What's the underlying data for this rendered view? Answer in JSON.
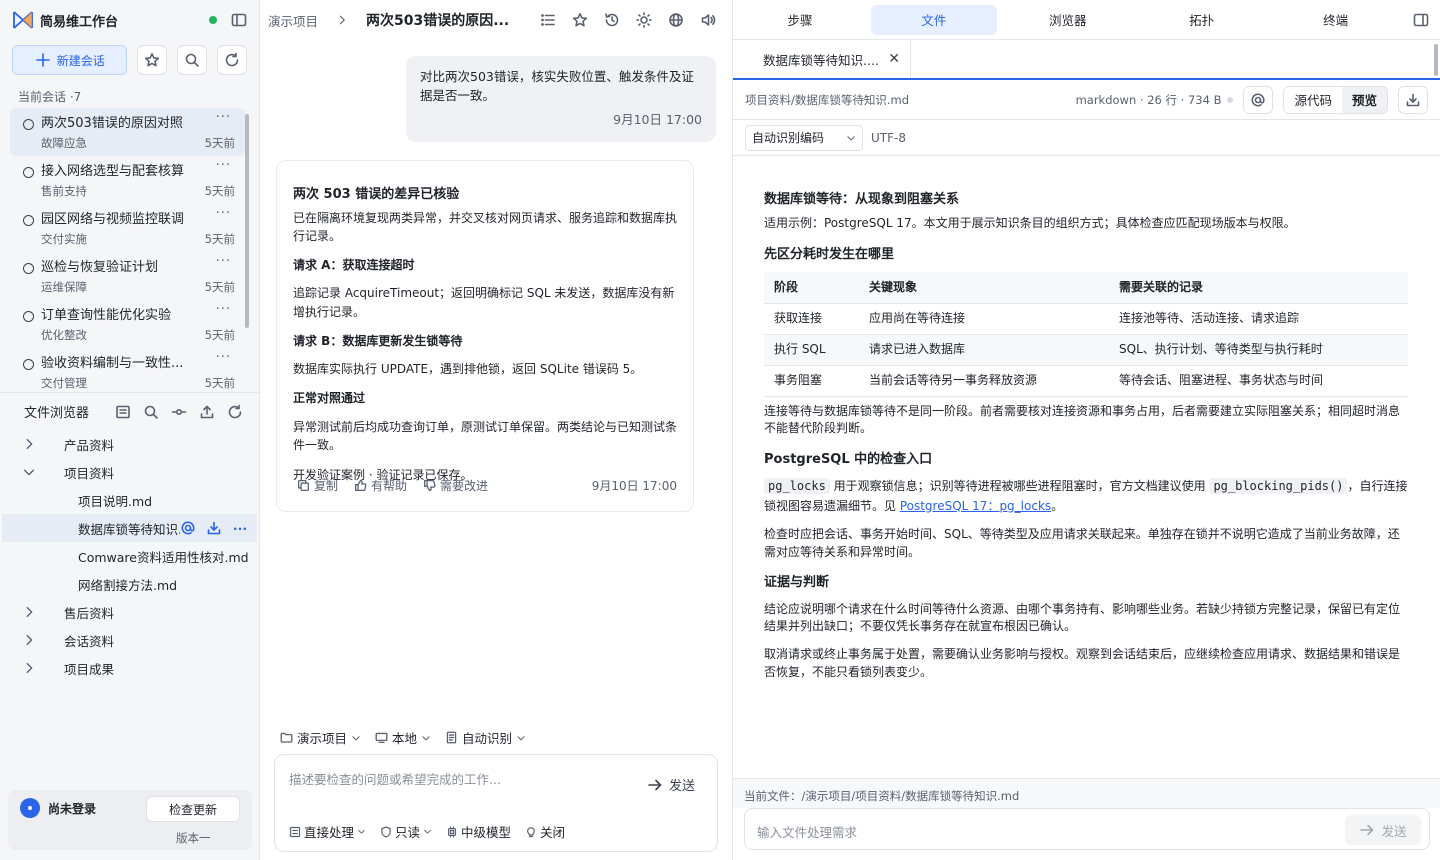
{
  "app": {
    "title": "简易维工作台"
  },
  "sidebar": {
    "new_chat_label": "新建会话",
    "section_label": "当前会话 ·7",
    "sessions": [
      {
        "title": "两次503错误的原因对照",
        "tag": "故障应急",
        "age": "5天前"
      },
      {
        "title": "接入网络选型与配套核算",
        "tag": "售前支持",
        "age": "5天前"
      },
      {
        "title": "园区网络与视频监控联调",
        "tag": "交付实施",
        "age": "5天前"
      },
      {
        "title": "巡检与恢复验证计划",
        "tag": "运维保障",
        "age": "5天前"
      },
      {
        "title": "订单查询性能优化实验",
        "tag": "优化整改",
        "age": "5天前"
      },
      {
        "title": "验收资料编制与一致性...",
        "tag": "交付管理",
        "age": "5天前"
      }
    ],
    "file_browser_label": "文件浏览器",
    "tree": {
      "folder1": "产品资料",
      "folder2": "项目资料",
      "file1": "项目说明.md",
      "file2": "数据库锁等待知识.md",
      "file3": "Comware资料适用性核对.md",
      "file4": "网络割接方法.md",
      "folder3": "售后资料",
      "folder4": "会话资料",
      "folder5": "项目成果"
    },
    "footer": {
      "user": "尚未登录",
      "update_label": "检查更新",
      "version": "版本一"
    }
  },
  "chat": {
    "crumb_project": "演示项目",
    "crumb_title": "两次503错误的原因...",
    "user_msg": "对比两次503错误，核实失败位置、触发条件及证据是否一致。",
    "user_time": "9月10日 17:00",
    "ai": {
      "title": "两次 503 错误的差异已核验",
      "intro": "已在隔离环境复现两类异常，并交叉核对网页请求、服务追踪和数据库执行记录。",
      "h_a": "请求 A：获取连接超时",
      "p_a": "追踪记录 AcquireTimeout；返回明确标记 SQL 未发送，数据库没有新增执行记录。",
      "h_b": "请求 B：数据库更新发生锁等待",
      "p_b": "数据库实际执行 UPDATE，遇到排他锁，返回 SQLite 错误码 5。",
      "h_c": "正常对照通过",
      "p_c": "异常测试前后均成功查询订单，原测试订单保留。两类结论与已知测试条件一致。",
      "foot": "开发验证案例 · 验证记录已保存。",
      "copy": "复制",
      "helpful": "有帮助",
      "improve": "需要改进",
      "time": "9月10日 17:00"
    },
    "ctx": {
      "project": "演示项目",
      "env": "本地",
      "mode": "自动识别"
    },
    "composer": {
      "placeholder": "描述要检查的问题或希望完成的工作...",
      "send": "发送",
      "opt1": "直接处理",
      "opt2": "只读",
      "opt3": "中级模型",
      "opt4": "关闭"
    }
  },
  "right": {
    "tabs": [
      "步骤",
      "文件",
      "浏览器",
      "拓扑",
      "终端"
    ],
    "active_tab": "文件",
    "file_tab": "数据库锁等待知识....",
    "path": "项目资料/数据库锁等待知识.md",
    "meta": "markdown · 26 行 · 734 B",
    "view_source": "源代码",
    "view_preview": "预览",
    "encoding_select": "自动识别编码",
    "encoding_value": "UTF-8",
    "doc": {
      "h1": "数据库锁等待：从现象到阻塞关系",
      "p1": "适用示例：PostgreSQL 17。本文用于展示知识条目的组织方式；具体检查应匹配现场版本与权限。",
      "h2": "先区分耗时发生在哪里",
      "table_head": [
        "阶段",
        "关键现象",
        "需要关联的记录"
      ],
      "table_rows": [
        [
          "获取连接",
          "应用尚在等待连接",
          "连接池等待、活动连接、请求追踪"
        ],
        [
          "执行 SQL",
          "请求已进入数据库",
          "SQL、执行计划、等待类型与执行耗时"
        ],
        [
          "事务阻塞",
          "当前会话等待另一事务释放资源",
          "等待会话、阻塞进程、事务状态与时间"
        ]
      ],
      "p2": "连接等待与数据库锁等待不是同一阶段。前者需要核对连接资源和事务占用，后者需要建立实际阻塞关系；相同超时消息不能替代阶段判断。",
      "h3": "PostgreSQL 中的检查入口",
      "code1": "pg_locks",
      "p3a": " 用于观察锁信息；识别等待进程被哪些进程阻塞时，官方文档建议使用 ",
      "code2": "pg_blocking_pids()",
      "p3b": "，自行连接锁视图容易遗漏细节。见 ",
      "link": "PostgreSQL 17：pg_locks",
      "p3c": "。",
      "p4": "检查时应把会话、事务开始时间、SQL、等待类型及应用请求关联起来。单独存在锁并不说明它造成了当前业务故障，还需对应等待关系和异常时间。",
      "h4": "证据与判断",
      "p5": "结论应说明哪个请求在什么时间等待什么资源、由哪个事务持有、影响哪些业务。若缺少持锁方完整记录，保留已有定位结果并列出缺口；不要仅凭长事务存在就宣布根因已确认。",
      "p6": "取消请求或终止事务属于处置，需要确认业务影响与授权。观察到会话结束后，应继续检查应用请求、数据结果和错误是否恢复，不能只看锁列表变少。"
    },
    "current_file": "当前文件：/演示项目/项目资料/数据库锁等待知识.md",
    "input_placeholder": "输入文件处理需求",
    "input_send": "发送"
  },
  "colors": {
    "accent": "#2a64e8",
    "online": "#22b35e"
  }
}
